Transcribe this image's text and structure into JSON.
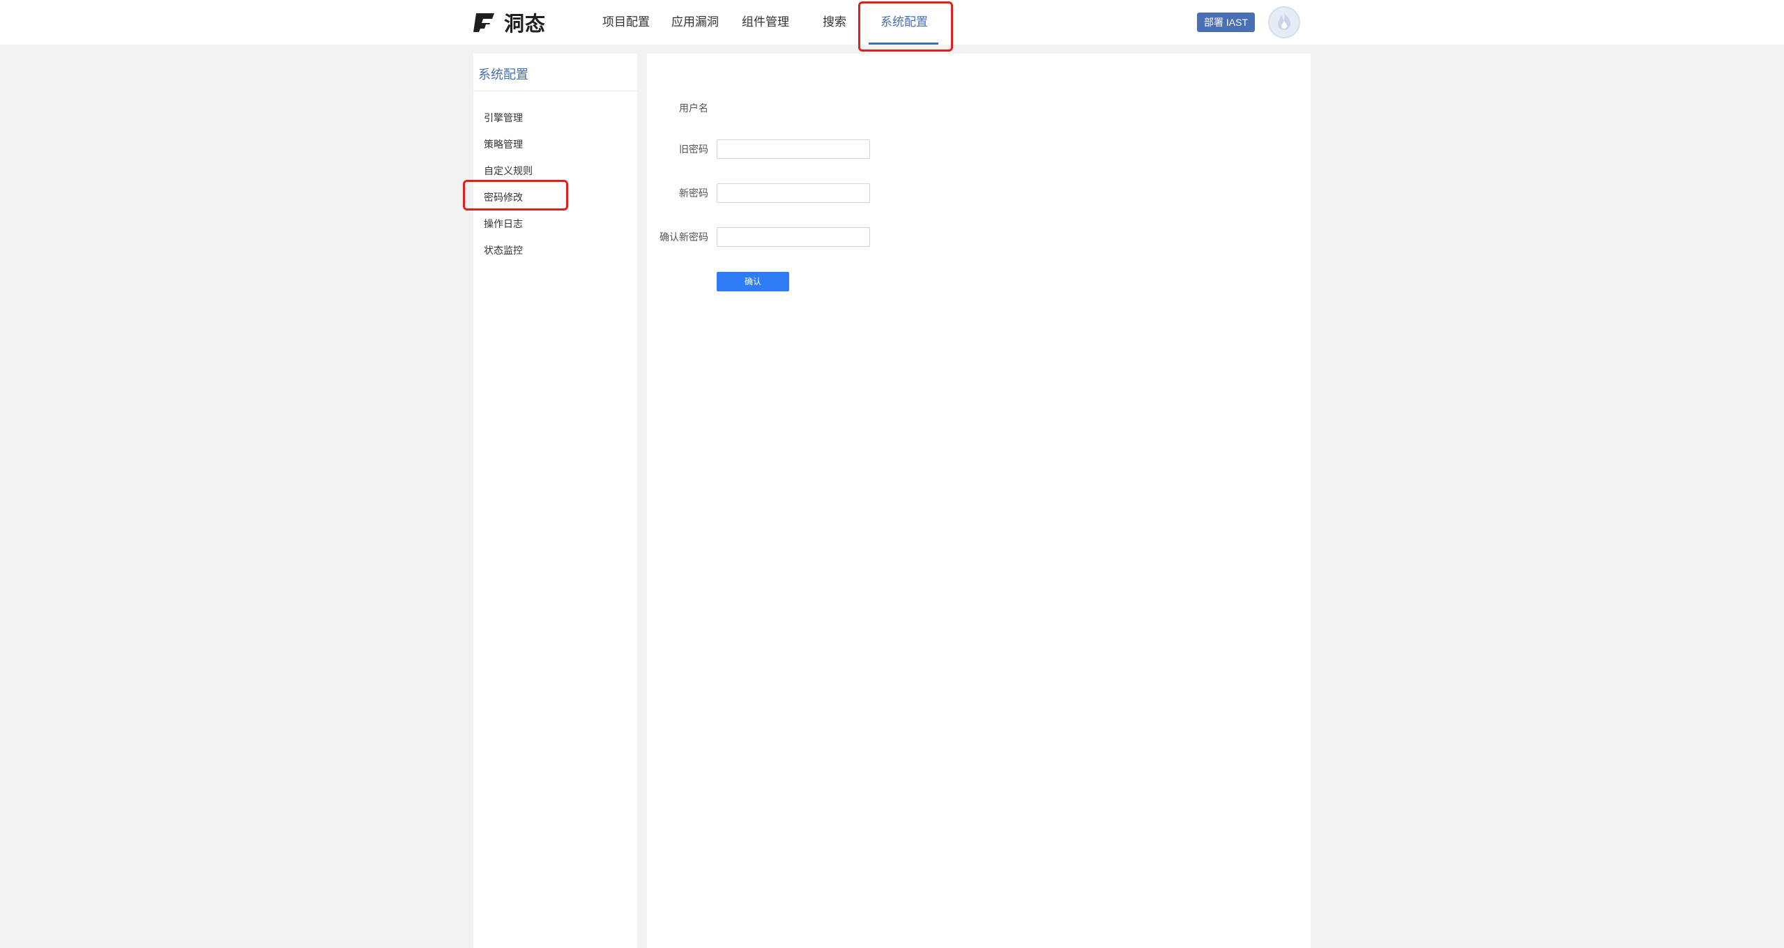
{
  "brand": {
    "name": "洞态"
  },
  "nav": {
    "items": [
      {
        "label": "项目配置",
        "active": false
      },
      {
        "label": "应用漏洞",
        "active": false
      },
      {
        "label": "组件管理",
        "active": false
      },
      {
        "label": "搜索",
        "active": false
      },
      {
        "label": "系统配置",
        "active": true
      }
    ],
    "deploy_label": "部署 IAST"
  },
  "sidebar": {
    "title": "系统配置",
    "items": [
      {
        "label": "引擎管理"
      },
      {
        "label": "策略管理"
      },
      {
        "label": "自定义规则"
      },
      {
        "label": "密码修改",
        "highlighted": true
      },
      {
        "label": "操作日志"
      },
      {
        "label": "状态监控"
      }
    ]
  },
  "form": {
    "username_label": "用户名",
    "username_value": "",
    "old_password_label": "旧密码",
    "new_password_label": "新密码",
    "confirm_password_label": "确认新密码",
    "old_password_value": "",
    "new_password_value": "",
    "confirm_password_value": "",
    "confirm_label": "确认"
  },
  "colors": {
    "accent": "#4a6fb5",
    "primary_button": "#2e7cf6",
    "highlight_box": "#e0201a",
    "background": "#f2f2f3"
  }
}
